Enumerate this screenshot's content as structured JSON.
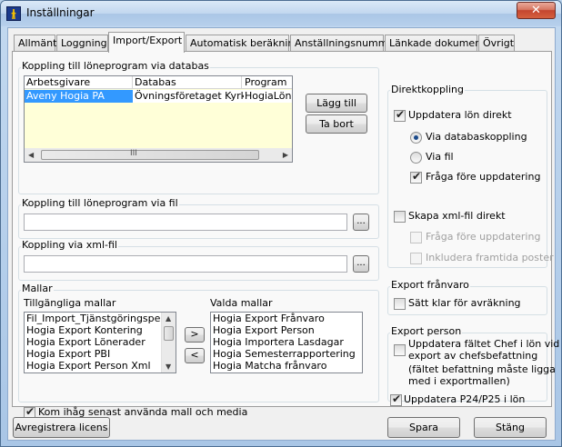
{
  "window": {
    "title": "Inställningar",
    "close_label": "✕"
  },
  "tabs": [
    {
      "label": "Allmänt"
    },
    {
      "label": "Loggning"
    },
    {
      "label": "Import/Export",
      "active": true
    },
    {
      "label": "Automatisk beräkning"
    },
    {
      "label": "Anställningsnummer"
    },
    {
      "label": "Länkade dokument"
    },
    {
      "label": "Övrigt"
    }
  ],
  "db_link": {
    "title": "Koppling till löneprogram via databas",
    "columns": [
      "Arbetsgivare",
      "Databas",
      "Program"
    ],
    "rows": [
      {
        "cells": [
          "Aveny Hogia PA",
          "Övningsföretaget Kyrkan",
          "HogiaLön P"
        ],
        "selected": true
      }
    ],
    "add_label": "Lägg till",
    "remove_label": "Ta bort",
    "scroll_grip": "III"
  },
  "file_link": {
    "title": "Koppling till löneprogram via fil",
    "value": "",
    "browse_label": "..."
  },
  "xml_link": {
    "title": "Koppling via xml-fil",
    "value": "",
    "browse_label": "..."
  },
  "templates": {
    "title": "Mallar",
    "available_label": "Tillgängliga mallar",
    "available": [
      "Fil_Import_Tjänstgöringsperiode",
      "Hogia Export Kontering",
      "Hogia Export Lönerader",
      "Hogia Export PBI",
      "Hogia Export Person Xml"
    ],
    "selected_label": "Valda mallar",
    "selected": [
      "Hogia Export Frånvaro",
      "Hogia Export Person",
      "Hogia Importera Lasdagar",
      "Hogia Semesterrapportering",
      "Hogia Matcha frånvaro"
    ],
    "move_right": ">",
    "move_left": "<",
    "remember_label": "Kom ihåg senast använda mall och media",
    "remember_checked": true
  },
  "direct": {
    "title": "Direktkoppling",
    "update_salary_label": "Uppdatera lön direkt",
    "update_salary_checked": true,
    "via_db_label": "Via databaskoppling",
    "via_db_selected": true,
    "via_file_label": "Via fil",
    "via_file_selected": false,
    "ask_before_label": "Fråga före uppdatering",
    "ask_before_checked": true,
    "create_xml_label": "Skapa xml-fil direkt",
    "create_xml_checked": false,
    "xml_ask_before_label": "Fråga före uppdatering",
    "include_future_label": "Inkludera framtida poster"
  },
  "export_absence": {
    "title": "Export frånvaro",
    "ready_label": "Sätt klar för avräkning",
    "ready_checked": false
  },
  "export_person": {
    "title": "Export person",
    "update_boss_label_1": "Uppdatera fältet Chef i lön vid",
    "update_boss_label_2": "export av chefsbefattning",
    "update_boss_note_1": "(fältet befattning måste ligga",
    "update_boss_note_2": "med i exportmallen)",
    "update_boss_checked": false,
    "update_p24_label": "Uppdatera P24/P25 i lön",
    "update_p24_checked": true
  },
  "footer": {
    "unregister_label": "Avregistrera licens",
    "save_label": "Spara",
    "close_label": "Stäng"
  }
}
